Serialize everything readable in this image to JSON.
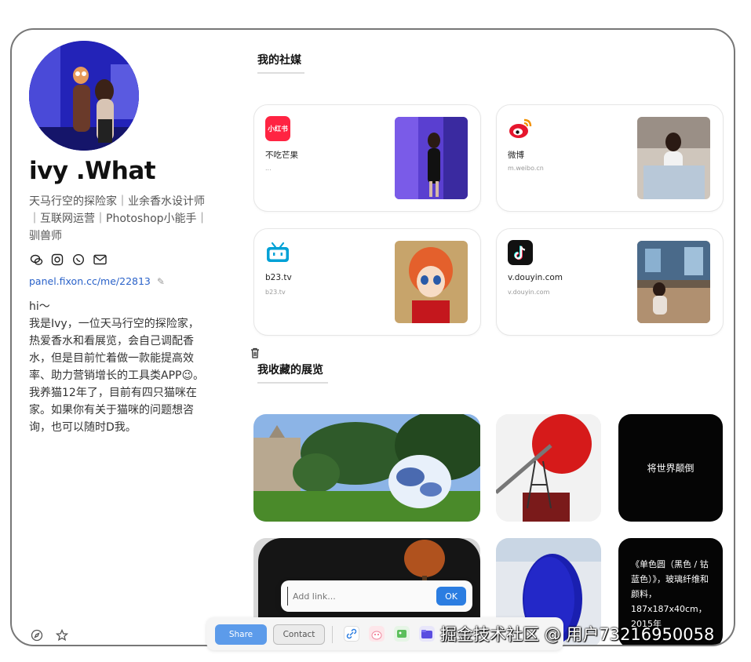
{
  "profile": {
    "name": "ivy .What",
    "tagline": "天马行空的探险家｜业余香水设计师｜互联网运营｜Photoshop小能手｜驯兽师",
    "link": "panel.fixon.cc/me/22813",
    "bio": [
      "hi～",
      "我是Ivy，一位天马行空的探险家，热爱香水和看展览，会自己调配香水，但是目前忙着做一款能提高效率、助力营销增长的工具类APP😉。",
      "我养猫12年了，目前有四只猫咪在家。如果你有关于猫咪的问题想咨询，也可以随时D我。"
    ],
    "social_icons": [
      "wechat-icon",
      "instagram-icon",
      "whatsapp-icon",
      "mail-icon"
    ],
    "bottom_icons": [
      "compass-icon",
      "star-icon"
    ]
  },
  "sections": {
    "social_title": "我的社媒",
    "gallery_title": "我收藏的展览"
  },
  "social_cards": [
    {
      "badge": "小红书",
      "title": "不吃芒果",
      "subtitle": "...",
      "icon": "xiaohongshu-icon",
      "color": "#ff2442"
    },
    {
      "badge": "",
      "title": "微博",
      "subtitle": "m.weibo.cn",
      "icon": "weibo-icon",
      "color": "#e6162d"
    },
    {
      "badge": "",
      "title": "b23.tv",
      "subtitle": "b23.tv",
      "icon": "bilibili-icon",
      "color": "#00a1d6"
    },
    {
      "badge": "",
      "title": "v.douyin.com",
      "subtitle": "v.douyin.com",
      "icon": "douyin-icon",
      "color": "#111111"
    }
  ],
  "gallery": {
    "tile3_caption": "将世界颠倒",
    "tile6_desc": "《单色圆（黑色 / 钴蓝色）》，玻璃纤维和颜料，187x187x40cm，2015年"
  },
  "add_link": {
    "placeholder": "Add link...",
    "ok_label": "OK"
  },
  "toolbar": {
    "share_label": "Share",
    "contact_label": "Contact"
  },
  "watermark": "掘金技术社区 @ 用户73216950058"
}
